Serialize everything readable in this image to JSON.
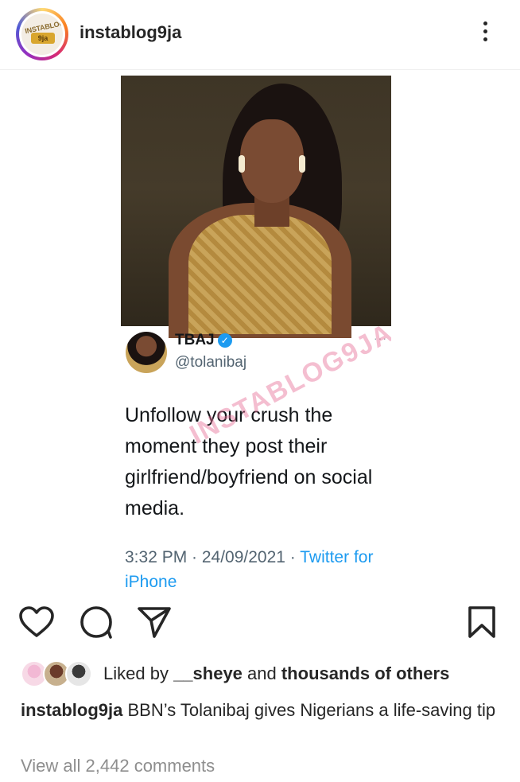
{
  "header": {
    "username": "instablog9ja",
    "avatar_logo_top": "INSTABLOG",
    "avatar_logo_badge": "9ja",
    "more_icon": "more-vertical-icon"
  },
  "post": {
    "tweet": {
      "name": "TBAJ",
      "handle": "@tolanibaj",
      "more": "···",
      "text": "Unfollow your crush the moment they post their girlfriend/boyfriend on social media.",
      "watermark": "INSTABLOG9JA",
      "time": "3:32 PM · 24/09/2021 · ",
      "source": "Twitter for iPhone"
    }
  },
  "actions": {
    "like_icon": "heart-icon",
    "comment_icon": "comment-icon",
    "share_icon": "send-icon",
    "save_icon": "bookmark-icon"
  },
  "likes": {
    "prefix": "Liked by ",
    "user": "__sheye",
    "middle": " and ",
    "others": "thousands of others"
  },
  "caption": {
    "username": "instablog9ja",
    "text": " BBN’s Tolanibaj gives Nigerians a life-saving tip"
  },
  "comments": {
    "view_all": "View all 2,442 comments"
  }
}
